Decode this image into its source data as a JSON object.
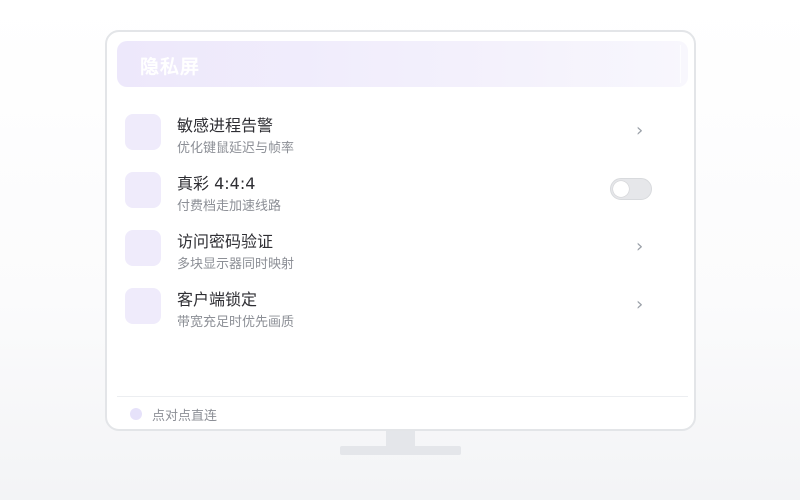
{
  "header": {
    "title": "隐私屏"
  },
  "items": [
    {
      "title": "敏感进程告警",
      "subtitle": "优化键鼠延迟与帧率",
      "control": "chevron"
    },
    {
      "title": "真彩 4:4:4",
      "subtitle": "付费档走加速线路",
      "control": "toggle",
      "toggle_on": false
    },
    {
      "title": "访问密码验证",
      "subtitle": "多块显示器同时映射",
      "control": "chevron"
    },
    {
      "title": "客户端锁定",
      "subtitle": "带宽充足时优先画质",
      "control": "chevron"
    }
  ],
  "icons": {
    "chevron": "›",
    "item_icon": "settings-item-icon",
    "status_dot": "status-dot-icon"
  },
  "footer": {
    "status_text": "点对点直连"
  },
  "colors": {
    "accent_light": "#efebfb",
    "header_gradient_start": "#ede8fb",
    "text_primary": "#2e2e33",
    "text_secondary": "#8c8f96",
    "border": "#e3e5e8"
  }
}
